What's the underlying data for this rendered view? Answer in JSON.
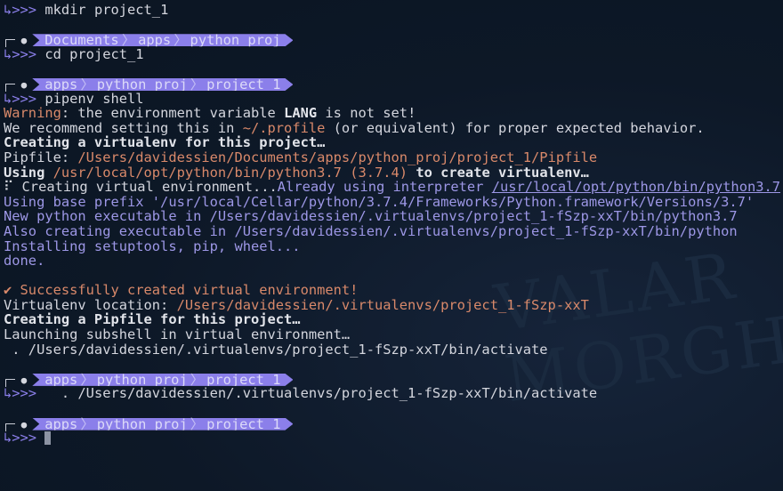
{
  "colors": {
    "background": "#0d1827",
    "prompt": "#8b7fea",
    "path": "#d9896a",
    "info": "#9d97e6",
    "text": "#c9ccd6"
  },
  "watermark": "VALAR MORGHULIS",
  "prompt_symbol": "↳>>>",
  "apple_icon": "",
  "lines": [
    {
      "type": "cmd",
      "command": "mkdir project_1"
    },
    {
      "type": "blank"
    },
    {
      "type": "prompt",
      "crumbs": [
        "Documents",
        "apps",
        "python_proj"
      ]
    },
    {
      "type": "cmd",
      "command": "cd project_1"
    },
    {
      "type": "blank"
    },
    {
      "type": "prompt",
      "crumbs": [
        "apps",
        "python_proj",
        "project_1"
      ]
    },
    {
      "type": "cmd",
      "command": "pipenv shell"
    },
    {
      "type": "out",
      "segs": [
        {
          "t": "Warning",
          "c": "o"
        },
        {
          "t": ": the environment variable ",
          "c": "w"
        },
        {
          "t": "LANG",
          "c": "b"
        },
        {
          "t": " is not set!",
          "c": "w"
        }
      ]
    },
    {
      "type": "out",
      "segs": [
        {
          "t": "We recommend setting this in ",
          "c": "w"
        },
        {
          "t": "~/.profile",
          "c": "o"
        },
        {
          "t": " (or equivalent) for proper expected behavior.",
          "c": "w"
        }
      ]
    },
    {
      "type": "out",
      "segs": [
        {
          "t": "Creating a virtualenv for this project…",
          "c": "b"
        }
      ]
    },
    {
      "type": "out",
      "segs": [
        {
          "t": "Pipfile: ",
          "c": "w"
        },
        {
          "t": "/Users/davidessien/Documents/apps/python_proj/project_1/Pipfile",
          "c": "o"
        }
      ]
    },
    {
      "type": "out",
      "segs": [
        {
          "t": "Using ",
          "c": "b"
        },
        {
          "t": "/usr/local/opt/python/bin/python3.7",
          "c": "o"
        },
        {
          "t": " (3.7.4)",
          "c": "o"
        },
        {
          "t": " to create virtualenv…",
          "c": "b"
        }
      ]
    },
    {
      "type": "out",
      "segs": [
        {
          "t": "⠏ Creating virtual environment...",
          "c": "w"
        },
        {
          "t": "Already using interpreter ",
          "c": "l"
        },
        {
          "t": "/usr/local/opt/python/bin/python3.7",
          "c": "u"
        }
      ]
    },
    {
      "type": "out",
      "segs": [
        {
          "t": "Using base prefix '/usr/local/Cellar/python/3.7.4/Frameworks/Python.framework/Versions/3.7'",
          "c": "l"
        }
      ]
    },
    {
      "type": "out",
      "segs": [
        {
          "t": "New python executable in /Users/davidessien/.virtualenvs/project_1-fSzp-xxT/bin/python3.7",
          "c": "l"
        }
      ]
    },
    {
      "type": "out",
      "segs": [
        {
          "t": "Also creating executable in /Users/davidessien/.virtualenvs/project_1-fSzp-xxT/bin/python",
          "c": "l"
        }
      ]
    },
    {
      "type": "out",
      "segs": [
        {
          "t": "Installing setuptools, pip, wheel...",
          "c": "l"
        }
      ]
    },
    {
      "type": "out",
      "segs": [
        {
          "t": "done.",
          "c": "l"
        }
      ]
    },
    {
      "type": "blank"
    },
    {
      "type": "out",
      "segs": [
        {
          "t": "✔ Successfully created virtual environment!",
          "c": "o"
        }
      ]
    },
    {
      "type": "out",
      "segs": [
        {
          "t": "Virtualenv location: ",
          "c": "w"
        },
        {
          "t": "/Users/davidessien/.virtualenvs/project_1-fSzp-xxT",
          "c": "o"
        }
      ]
    },
    {
      "type": "out",
      "segs": [
        {
          "t": "Creating a Pipfile for this project…",
          "c": "b"
        }
      ]
    },
    {
      "type": "out",
      "segs": [
        {
          "t": "Launching subshell in virtual environment…",
          "c": "w"
        }
      ]
    },
    {
      "type": "out",
      "segs": [
        {
          "t": " . /Users/davidessien/.virtualenvs/project_1-fSzp-xxT/bin/activate",
          "c": "w"
        }
      ]
    },
    {
      "type": "blank"
    },
    {
      "type": "prompt",
      "crumbs": [
        "apps",
        "python_proj",
        "project_1"
      ]
    },
    {
      "type": "cmd",
      "command": "  . /Users/davidessien/.virtualenvs/project_1-fSzp-xxT/bin/activate"
    },
    {
      "type": "blank"
    },
    {
      "type": "prompt",
      "crumbs": [
        "apps",
        "python_proj",
        "project_1"
      ]
    },
    {
      "type": "cmd",
      "command": "",
      "cursor": true
    }
  ]
}
